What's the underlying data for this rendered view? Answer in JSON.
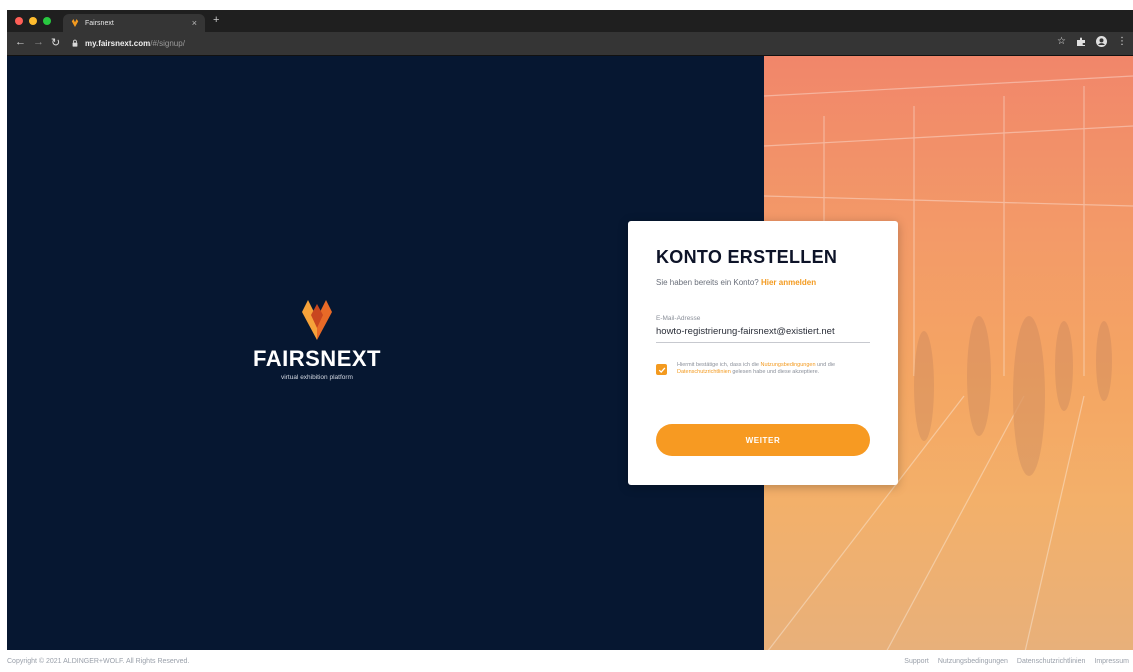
{
  "browser": {
    "tab_title": "Fairsnext",
    "new_tab_label": "+",
    "close_label": "×",
    "url_host": "my.fairsnext.com",
    "url_path": "/#/signup/",
    "traffic_colors": [
      "#ff5f57",
      "#febc2e",
      "#28c840"
    ]
  },
  "brand": {
    "name": "FAIRSNEXT",
    "tagline": "virtual exhibition platform",
    "accent": "#f39a1f",
    "background": "#061731"
  },
  "form": {
    "title": "KONTO ERSTELLEN",
    "subline_prefix": "Sie haben bereits ein Konto?",
    "signin_link": "Hier anmelden",
    "email_label": "E-Mail-Adresse",
    "email_value": "howto-registrierung-fairsnext@existiert.net",
    "consent_prefix": "Hiermit bestätige ich, dass ich die",
    "consent_terms_link": "Nutzungsbedingungen",
    "consent_and": "und die",
    "consent_privacy_link": "Datenschutzrichtlinien",
    "consent_suffix": "gelesen habe und diese akzeptiere.",
    "consent_checked": true,
    "submit_label": "WEITER"
  },
  "footer": {
    "copyright": "Copyright © 2021 ALDINGER+WOLF. All Rights Reserved.",
    "links": [
      "Support",
      "Nutzungsbedingungen",
      "Datenschutzrichtlinien",
      "Impressum"
    ]
  },
  "icons": {
    "back": "arrow-left-icon",
    "forward": "arrow-right-icon",
    "reload": "reload-icon",
    "lock": "lock-icon",
    "star": "star-icon",
    "extensions": "puzzle-icon",
    "profile": "profile-icon",
    "menu": "kebab-menu-icon",
    "check": "check-icon"
  }
}
